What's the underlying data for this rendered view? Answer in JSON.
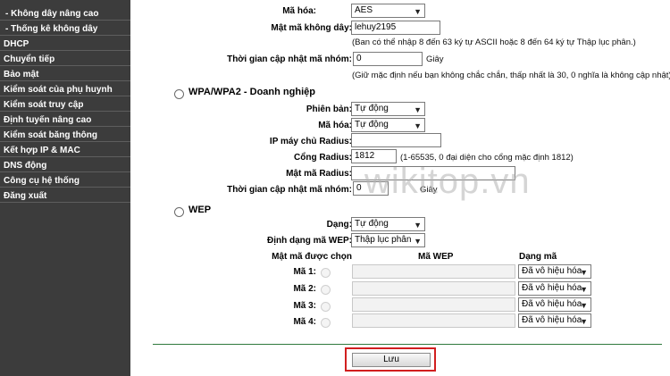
{
  "sidebar": {
    "items": [
      {
        "label": "- Không dây nâng cao"
      },
      {
        "label": "- Thống kê không dây"
      },
      {
        "label": "DHCP"
      },
      {
        "label": "Chuyển tiếp"
      },
      {
        "label": "Bảo mật"
      },
      {
        "label": "Kiểm soát của phụ huynh"
      },
      {
        "label": "Kiểm soát truy cập"
      },
      {
        "label": "Định tuyến nâng cao"
      },
      {
        "label": "Kiểm soát băng thông"
      },
      {
        "label": "Kết hợp IP & MAC"
      },
      {
        "label": "DNS động"
      },
      {
        "label": "Công cụ hệ thống"
      },
      {
        "label": "Đăng xuất"
      }
    ]
  },
  "wpa_personal": {
    "encryption_label": "Mã hóa:",
    "encryption_value": "AES",
    "password_label": "Mật mã không dây:",
    "password_value": "lehuy2195",
    "password_hint": "(Ban có thể nhập 8 đến 63 ký tự ASCII hoặc 8 đến 64 ký tự Thập lục phân.)",
    "group_key_label": "Thời gian cập nhật mã nhóm:",
    "group_key_value": "0",
    "group_key_unit": "Giây",
    "group_key_hint": "(Giữ mặc định nếu bạn không chắc chắn, thấp nhất là 30, 0 nghĩa là không cập nhật)"
  },
  "wpa_enterprise": {
    "title": "WPA/WPA2 - Doanh nghiệp",
    "version_label": "Phiên bản:",
    "version_value": "Tự động",
    "encryption_label": "Mã hóa:",
    "encryption_value": "Tự động",
    "radius_ip_label": "IP máy chủ Radius:",
    "radius_ip_value": "",
    "radius_port_label": "Cổng Radius:",
    "radius_port_value": "1812",
    "radius_port_hint": "(1-65535, 0 đại diện cho cổng mặc định 1812)",
    "radius_pass_label": "Mật mã Radius:",
    "radius_pass_value": "",
    "group_key_label": "Thời gian cập nhật mã nhóm:",
    "group_key_value": "0",
    "group_key_unit": "Giây"
  },
  "wep": {
    "title": "WEP",
    "type_label": "Dạng:",
    "type_value": "Tự động",
    "format_label": "Định dạng mã WEP:",
    "format_value": "Thập lục phân",
    "selected_key_header": "Mật mã được chọn",
    "wep_key_header": "Mã WEP",
    "key_type_header": "Dạng mã",
    "keys": [
      {
        "label": "Mã 1:",
        "value": "",
        "type": "Đã vô hiệu hóa"
      },
      {
        "label": "Mã 2:",
        "value": "",
        "type": "Đã vô hiệu hóa"
      },
      {
        "label": "Mã 3:",
        "value": "",
        "type": "Đã vô hiệu hóa"
      },
      {
        "label": "Mã 4:",
        "value": "",
        "type": "Đã vô hiệu hóa"
      }
    ]
  },
  "save_label": "Lưu",
  "watermark": "wikitop.vn",
  "colors": {
    "sidebar_bg": "#3c3c3c",
    "divider": "#2f7a3d",
    "highlight_box": "#d11f1f"
  },
  "icons": {
    "dropdown": "chevron-down-icon",
    "radio": "radio-icon"
  }
}
